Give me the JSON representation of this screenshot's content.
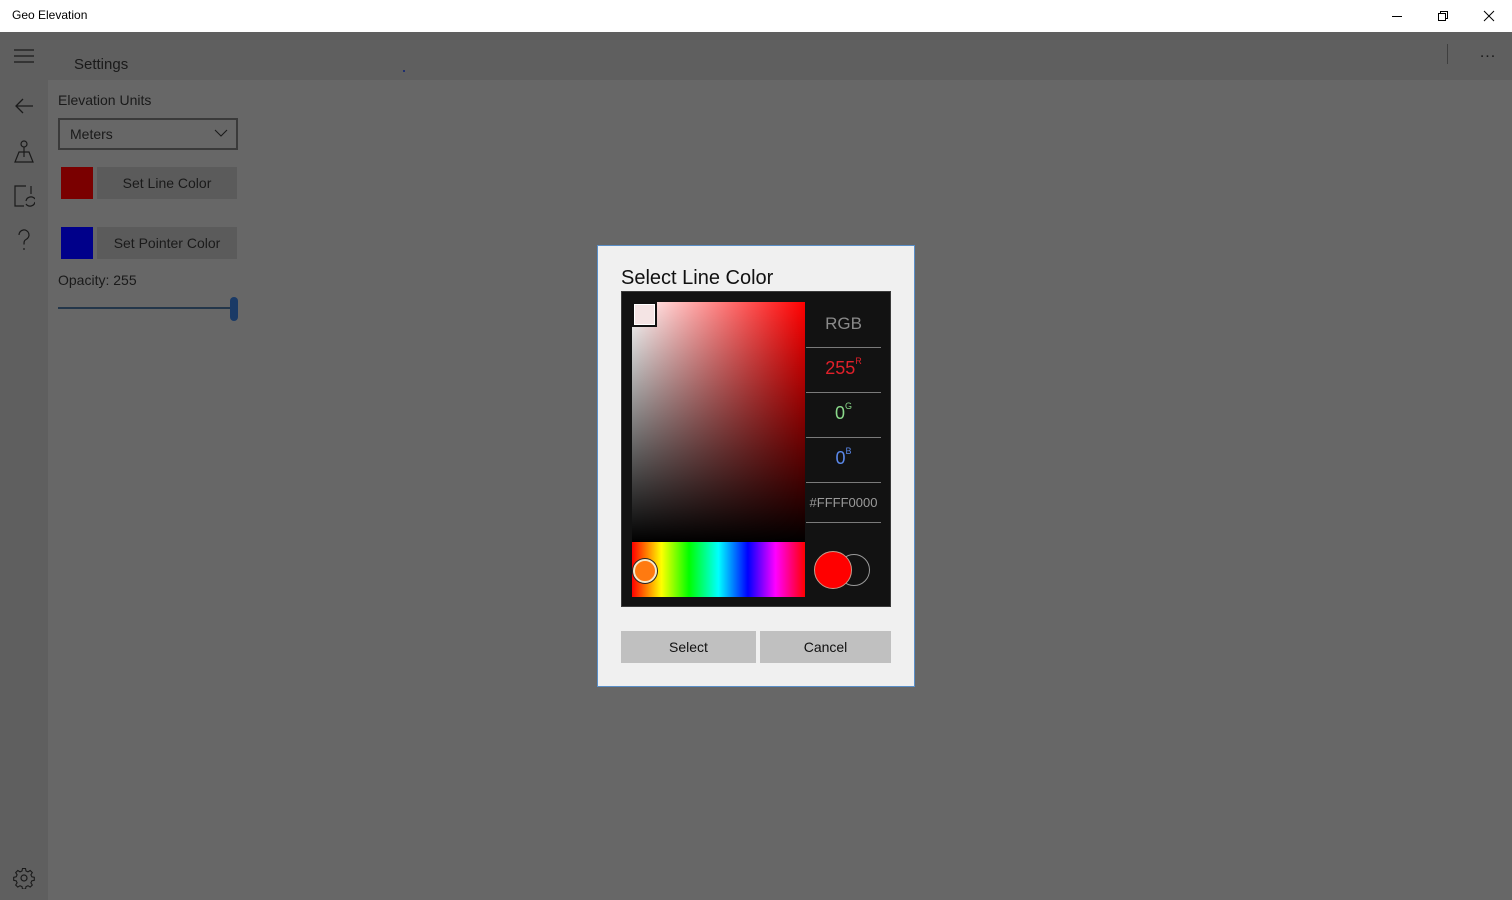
{
  "window": {
    "title": "Geo Elevation",
    "controls": {
      "minimize": "minimize",
      "maximize": "restore",
      "close": "close"
    }
  },
  "nav": {
    "items": [
      {
        "icon": "hamburger-menu-icon",
        "label": "Menu"
      },
      {
        "icon": "back-arrow-icon",
        "label": "Back"
      },
      {
        "icon": "elevation-marker-icon",
        "label": "Elevation"
      },
      {
        "icon": "sync-document-icon",
        "label": "Refresh"
      },
      {
        "icon": "help-icon",
        "label": "Help"
      },
      {
        "icon": "gear-icon",
        "label": "Settings"
      }
    ]
  },
  "header": {
    "title": "Settings",
    "more_label": "..."
  },
  "settings": {
    "elevation_units_label": "Elevation Units",
    "elevation_units_value": "Meters",
    "line_color": {
      "button_label": "Set Line Color",
      "swatch": "#7a0000"
    },
    "pointer_color": {
      "button_label": "Set Pointer Color",
      "swatch": "#00008a"
    },
    "opacity_label": "Opacity: 255",
    "opacity_value": 255,
    "opacity_max": 255
  },
  "dialog": {
    "title": "Select Line Color",
    "mode_label": "RGB",
    "r_value": "255",
    "r_label": "R",
    "g_value": "0",
    "g_label": "G",
    "b_value": "0",
    "b_label": "B",
    "hex_value": "#FFFF0000",
    "new_color": "#ff0000",
    "select_label": "Select",
    "cancel_label": "Cancel"
  }
}
